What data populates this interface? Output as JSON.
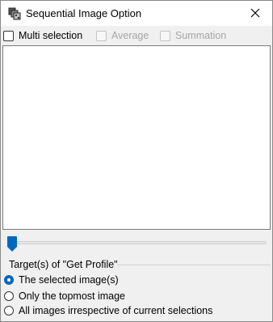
{
  "window": {
    "title": "Sequential Image Option"
  },
  "options": {
    "multi_selection": {
      "label": "Multi selection",
      "checked": false,
      "enabled": true
    },
    "average": {
      "label": "Average",
      "checked": false,
      "enabled": false
    },
    "summation": {
      "label": "Summation",
      "checked": false,
      "enabled": false
    }
  },
  "image_list": {
    "items": []
  },
  "slider": {
    "value_fraction": 0
  },
  "targets": {
    "group_label": "Target(s) of \"Get Profile\"",
    "choices": [
      {
        "label": "The selected image(s)",
        "selected": true
      },
      {
        "label": "Only the topmost image",
        "selected": false
      },
      {
        "label": "All images irrespective of current selections",
        "selected": false
      }
    ]
  },
  "colors": {
    "accent": "#0067c0",
    "background": "#f0f0f0",
    "list_background": "#ffffff"
  },
  "icons": {
    "app": "stacked-images-icon",
    "close": "close-icon"
  }
}
